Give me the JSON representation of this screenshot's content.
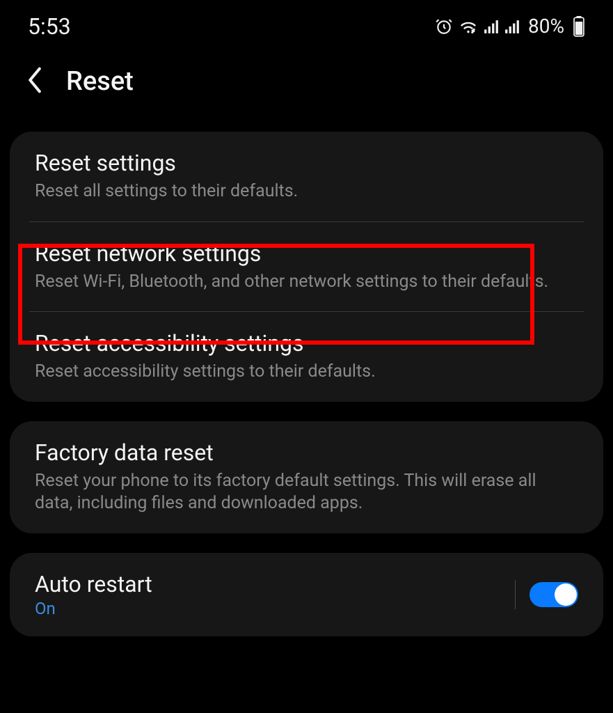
{
  "statusbar": {
    "time": "5:53",
    "battery_pct": "80%"
  },
  "header": {
    "title": "Reset"
  },
  "sections": {
    "reset_settings": {
      "title": "Reset settings",
      "desc": "Reset all settings to their defaults."
    },
    "reset_network": {
      "title": "Reset network settings",
      "desc": "Reset Wi-Fi, Bluetooth, and other network settings to their defaults."
    },
    "reset_accessibility": {
      "title": "Reset accessibility settings",
      "desc": "Reset accessibility settings to their defaults."
    },
    "factory_reset": {
      "title": "Factory data reset",
      "desc": "Reset your phone to its factory default settings. This will erase all data, including files and downloaded apps."
    },
    "auto_restart": {
      "title": "Auto restart",
      "status": "On"
    }
  }
}
